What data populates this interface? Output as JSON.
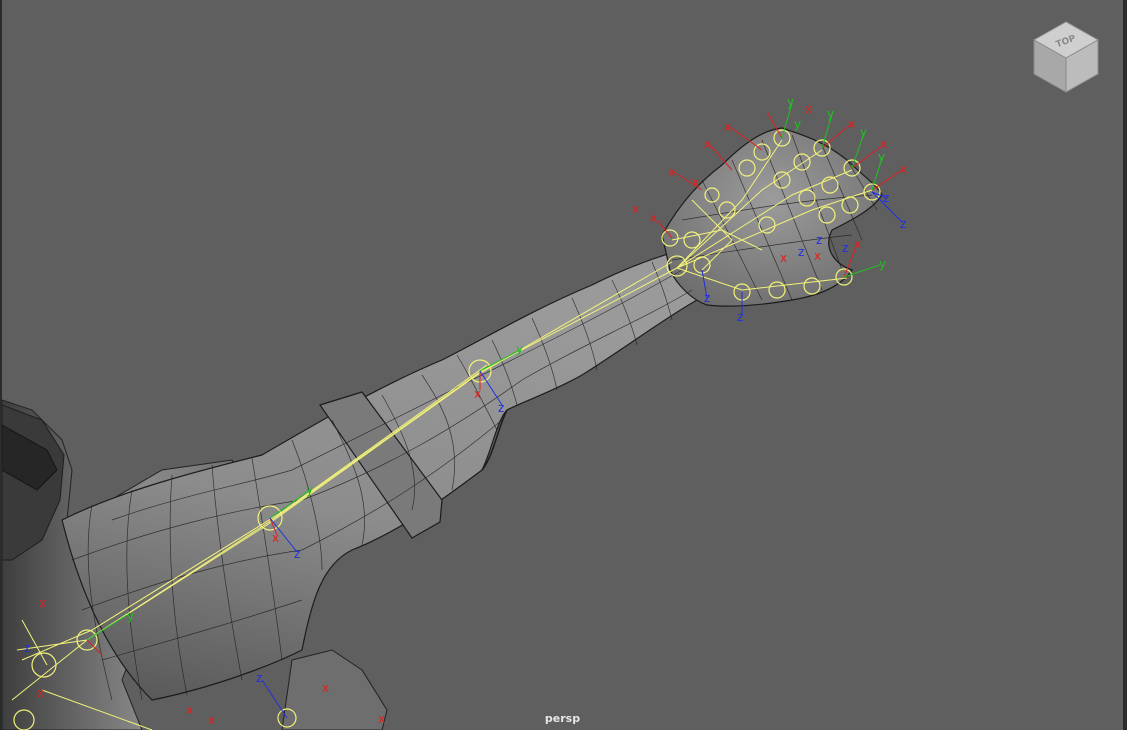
{
  "viewport": {
    "camera": "persp",
    "background_color": "#5f5f5f",
    "border_color": "#2b2b2b"
  },
  "viewcube": {
    "face_label": "TOP",
    "icon": "viewcube-icon"
  },
  "scene": {
    "mesh": "character-arm-mesh",
    "skeleton": "joint-chain",
    "joint_color": "#f2f27a",
    "axis_colors": {
      "x": "#e02020",
      "y": "#20c020",
      "z": "#2030e0"
    },
    "axis_labels": {
      "x": "x",
      "y": "y",
      "z": "z"
    }
  }
}
